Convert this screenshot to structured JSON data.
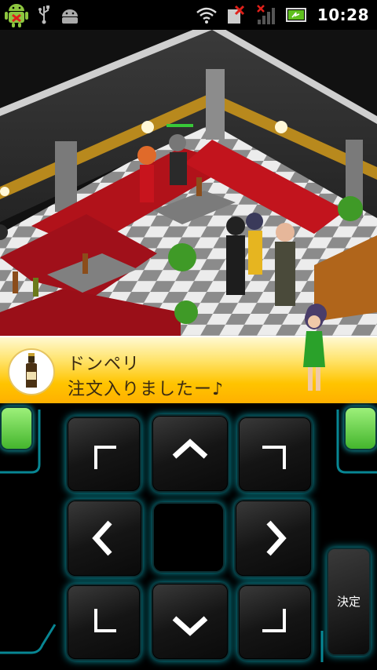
{
  "status_bar": {
    "time": "10:28",
    "icons": [
      "android-robot-icon",
      "usb-icon",
      "android-debug-icon",
      "wifi-icon",
      "sim-error-icon",
      "signal-icon",
      "battery-icon"
    ]
  },
  "notification": {
    "item_name": "ドンペリ",
    "message": "注文入りましたー♪",
    "icon": "champagne-bottle-icon"
  },
  "controller": {
    "buttons": [
      "up-left",
      "up",
      "up-right",
      "left",
      "center",
      "right",
      "down-left",
      "down",
      "down-right"
    ],
    "decide_label": "決定"
  },
  "colors": {
    "glow": "#0aa8b8",
    "notice_bg": "#ffd23a",
    "side_button": "#7fe060"
  }
}
